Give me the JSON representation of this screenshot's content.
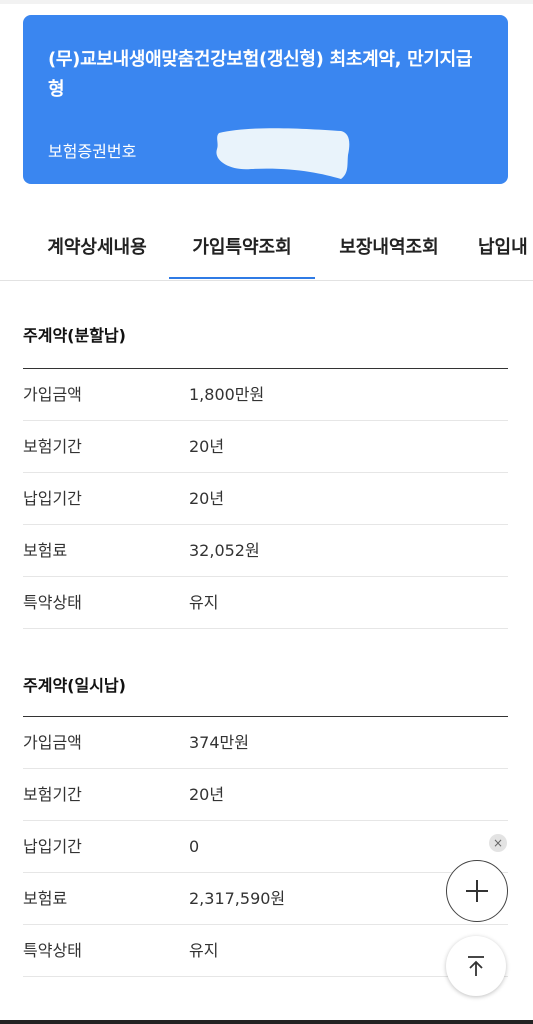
{
  "contract": {
    "title": "(무)교보내생애맞춤건강보험(갱신형) 최초계약, 만기지급형",
    "policy_number_label": "보험증권번호"
  },
  "tabs": [
    {
      "label": "계약상세내용",
      "active": false
    },
    {
      "label": "가입특약조회",
      "active": true
    },
    {
      "label": "보장내역조회",
      "active": false
    },
    {
      "label": "납입내",
      "active": false
    }
  ],
  "sections": [
    {
      "title": "주계약(분할납)",
      "rows": [
        {
          "label": "가입금액",
          "value": "1,800만원"
        },
        {
          "label": "보험기간",
          "value": "20년"
        },
        {
          "label": "납입기간",
          "value": "20년"
        },
        {
          "label": "보험료",
          "value": "32,052원"
        },
        {
          "label": "특약상태",
          "value": "유지"
        }
      ]
    },
    {
      "title": "주계약(일시납)",
      "rows": [
        {
          "label": "가입금액",
          "value": "374만원"
        },
        {
          "label": "보험기간",
          "value": "20년"
        },
        {
          "label": "납입기간",
          "value": "0"
        },
        {
          "label": "보험료",
          "value": "2,317,590원"
        },
        {
          "label": "특약상태",
          "value": "유지"
        }
      ]
    }
  ],
  "icons": {
    "close": "×",
    "plus": "plus-icon",
    "scroll_top": "arrow-up-to-line-icon"
  },
  "colors": {
    "card_bg": "#3a86f0",
    "active_tab_underline": "#2f7be5"
  }
}
